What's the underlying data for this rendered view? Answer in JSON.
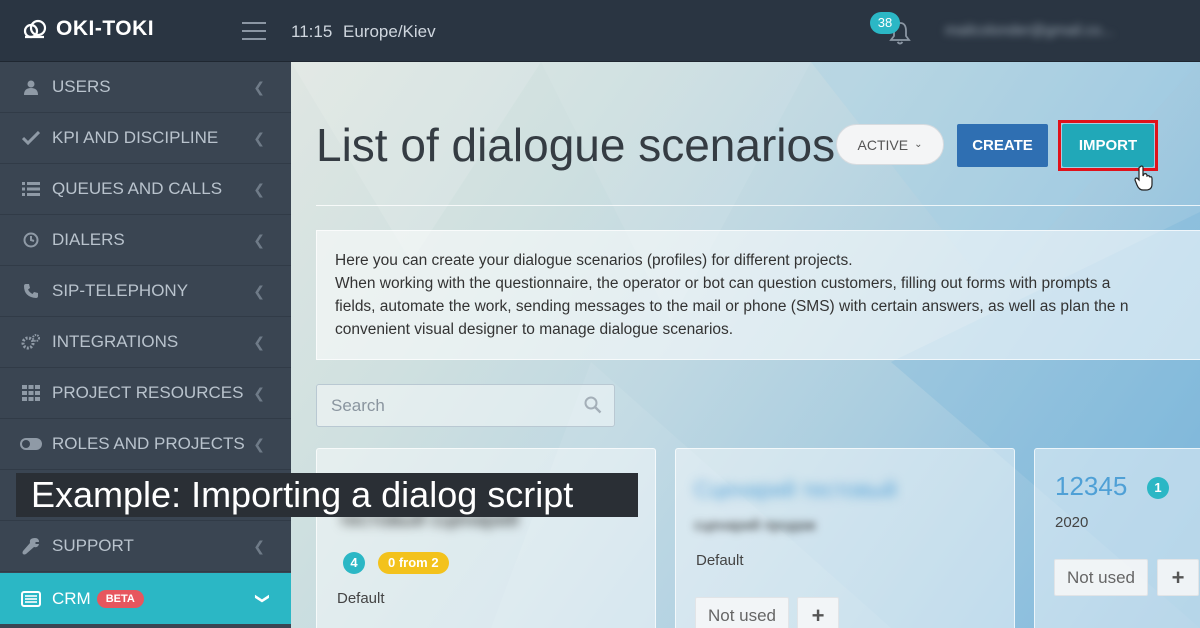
{
  "header": {
    "brand": "OKI-TOKI",
    "time": "11:15",
    "timezone": "Europe/Kiev",
    "notification_count": "38",
    "user_email": "mailcolonder@gmail.co..."
  },
  "sidebar": {
    "items": [
      {
        "label": "USERS",
        "icon": "user-icon"
      },
      {
        "label": "KPI AND DISCIPLINE",
        "icon": "check-icon"
      },
      {
        "label": "QUEUES AND CALLS",
        "icon": "list-icon"
      },
      {
        "label": "DIALERS",
        "icon": "clock-icon"
      },
      {
        "label": "SIP-TELEPHONY",
        "icon": "phone-icon"
      },
      {
        "label": "INTEGRATIONS",
        "icon": "gears-icon"
      },
      {
        "label": "PROJECT RESOURCES",
        "icon": "grid-icon"
      },
      {
        "label": "ROLES AND PROJECTS",
        "icon": "toggle-icon"
      },
      {
        "label": "",
        "icon": ""
      },
      {
        "label": "SUPPORT",
        "icon": "wrench-icon"
      }
    ],
    "active_item": {
      "label": "CRM",
      "badge": "BETA",
      "icon": "crm-icon"
    }
  },
  "main": {
    "title": "List of dialogue scenarios",
    "filter_label": "ACTIVE",
    "create_label": "CREATE",
    "import_label": "IMPORT",
    "info_lines": [
      "Here you can create your dialogue scenarios (profiles) for different projects.",
      "When working with the questionnaire, the operator or bot can question customers, filling out forms with prompts a",
      "fields, automate the work, sending messages to the mail or phone (SMS) with certain answers, as well as plan the n",
      "convenient visual designer to manage dialogue scenarios."
    ],
    "search_placeholder": "Search",
    "cards": [
      {
        "title": "тестовый сценарий",
        "sub": "",
        "count": "4",
        "usage": "0 from 2",
        "label": "Default"
      },
      {
        "title": "Сценарий тестовый",
        "sub": "сценарий продаж",
        "label": "Default",
        "status": "Not used",
        "plus": "+"
      },
      {
        "title": "12345",
        "count": "1",
        "label": "2020",
        "status": "Not used",
        "plus": "+"
      }
    ]
  },
  "caption": "Example: Importing a dialog script",
  "colors": {
    "accent": "#2bb7c5",
    "create": "#2f6fb2",
    "import": "#21a8b8",
    "highlight": "#e0121a",
    "sidebar": "#3a4552"
  }
}
